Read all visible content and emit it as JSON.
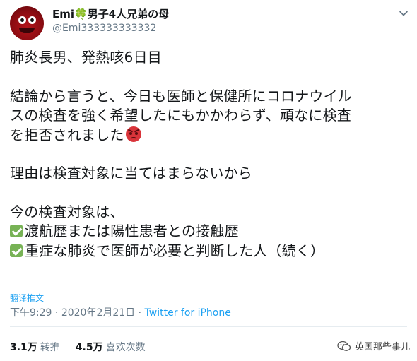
{
  "author": {
    "display_name": "Emi",
    "clover": "🍀",
    "name_suffix": "男子4人兄弟の母",
    "handle": "@Emi333333333332"
  },
  "tweet": {
    "lines": [
      "肺炎長男、発熱咳6日目",
      "結論から言うと、今日も医師と保健所にコロナウイル",
      "スの検査を強く希望したにもかかわらず、頑なに検査",
      "を拒否されました",
      "理由は検査対象に当てはまらないから",
      "今の検査対象は、",
      "渡航歴または陽性患者との接触歴",
      "重症な肺炎で医師が必要と判断した人（続く）"
    ]
  },
  "translate_label": "翻译推文",
  "meta": {
    "time": "下午9:29",
    "separator": " · ",
    "date": "2020年2月21日",
    "source": "Twitter for iPhone"
  },
  "stats": {
    "retweets_count": "3.1万",
    "retweets_label": "转推",
    "likes_count": "4.5万",
    "likes_label": "喜欢次数"
  },
  "watermark": {
    "text": "英国那些事儿"
  },
  "icons": {
    "more": "chevron-down-icon",
    "check": "check-mark-icon",
    "angry": "angry-face-icon",
    "watermark": "wechat-icon"
  },
  "colors": {
    "link": "#1da1f2",
    "secondary": "#657786",
    "check": "#77b255",
    "angry": "#d9343a"
  }
}
